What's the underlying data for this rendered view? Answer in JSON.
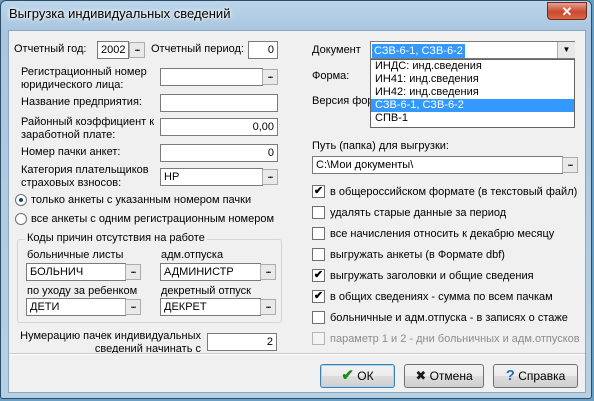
{
  "window": {
    "title": "Выгрузка индивидуальных сведений",
    "close_glyph": "✕"
  },
  "left": {
    "year_label": "Отчетный год:",
    "year_value": "2002",
    "period_label": "Отчетный период:",
    "period_value": "0",
    "regnum_label": "Регистрационный номер юридического лица:",
    "regnum_value": "",
    "name_label": "Название предприятия:",
    "name_value": "",
    "coef_label": "Районный коэффициент к заработной плате:",
    "coef_value": "0,00",
    "pack_label": "Номер пачки анкет:",
    "pack_value": "0",
    "category_label": "Категория плательщиков страховых взносов:",
    "category_value": "НР",
    "radio_only": "только анкеты с указанным номером пачки",
    "radio_all": "все анкеты с одним регистрационным номером",
    "codes_group": "Коды причин отсутствия на работе",
    "sick_label": "больничные листы",
    "sick_value": "БОЛЬНИЧ",
    "admleave_label": "адм.отпуска",
    "admleave_value": "АДМИНИСТР",
    "child_label": "по уходу за ребенком",
    "child_value": "ДЕТИ",
    "maternity_label": "декретный отпуск",
    "maternity_value": "ДЕКРЕТ",
    "numbering_label": "Нумерацию пачек индивидуальных сведений начинать с",
    "numbering_value": "2"
  },
  "right": {
    "doc_label": "Документ",
    "doc_value": "СЗВ-6-1, СЗВ-6-2",
    "form_label": "Форма:",
    "version_label": "Версия фор",
    "doc_options": [
      "ИНДС: инд.сведения",
      "ИН41: инд.сведения",
      "ИН42: инд.сведения",
      "СЗВ-6-1, СЗВ-6-2",
      "СПВ-1"
    ],
    "path_label": "Путь (папка) для выгрузки:",
    "path_value": "C:\\Мои документы\\",
    "checks": [
      {
        "label": "в общероссийском формате (в текстовый файл)",
        "checked": true
      },
      {
        "label": "удалять старые данные за период",
        "checked": false
      },
      {
        "label": "все начисления относить к декабрю месяцу",
        "checked": false
      },
      {
        "label": "выгружать анкеты (в Формате dbf)",
        "checked": false
      },
      {
        "label": "выгружать заголовки и общие сведения",
        "checked": true
      },
      {
        "label": "в общих сведениях - сумма по всем пачкам",
        "checked": true
      },
      {
        "label": "больничные и адм.отпуска - в записях о стаже",
        "checked": false
      },
      {
        "label": "параметр 1 и 2 - дни больничных и адм.отпусков",
        "checked": false
      }
    ]
  },
  "buttons": {
    "ok": "ОК",
    "cancel": "Отмена",
    "help": "Справка"
  },
  "icons": {
    "ellipsis": "...",
    "dropdown": "▼",
    "check": "✔",
    "ok": "✔",
    "cancel": "✖",
    "help": "?"
  },
  "colors": {
    "selection": "#3399ff",
    "ok_icon": "#1c8a1c",
    "cancel_icon": "#1a1a1a",
    "help_icon": "#2a6ebb"
  }
}
